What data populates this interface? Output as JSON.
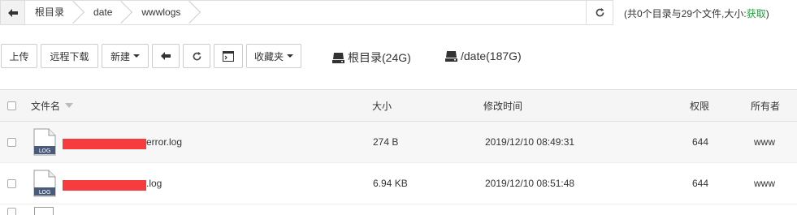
{
  "path": {
    "crumbs": [
      "根目录",
      "date",
      "wwwlogs"
    ]
  },
  "summary": {
    "text": "(共0个目录与29个文件,大小:",
    "link": "获取",
    "close": ")"
  },
  "toolbar": {
    "upload": "上传",
    "remote_download": "远程下载",
    "new": "新建",
    "favorites": "收藏夹"
  },
  "disks": [
    {
      "label": "根目录(24G)"
    },
    {
      "label": "/date(187G)"
    }
  ],
  "table": {
    "headers": {
      "name": "文件名",
      "size": "大小",
      "mtime": "修改时间",
      "perm": "权限",
      "owner": "所有者"
    },
    "rows": [
      {
        "name_suffix": "error.log",
        "size": "274 B",
        "mtime": "2019/12/10 08:49:31",
        "perm": "644",
        "owner": "www"
      },
      {
        "name_suffix": ".log",
        "size": "6.94 KB",
        "mtime": "2019/12/10 08:51:48",
        "perm": "644",
        "owner": "www"
      }
    ],
    "file_badge": "LOG"
  },
  "colors": {
    "accent": "#20a53a",
    "redaction": "#f63c3c"
  }
}
